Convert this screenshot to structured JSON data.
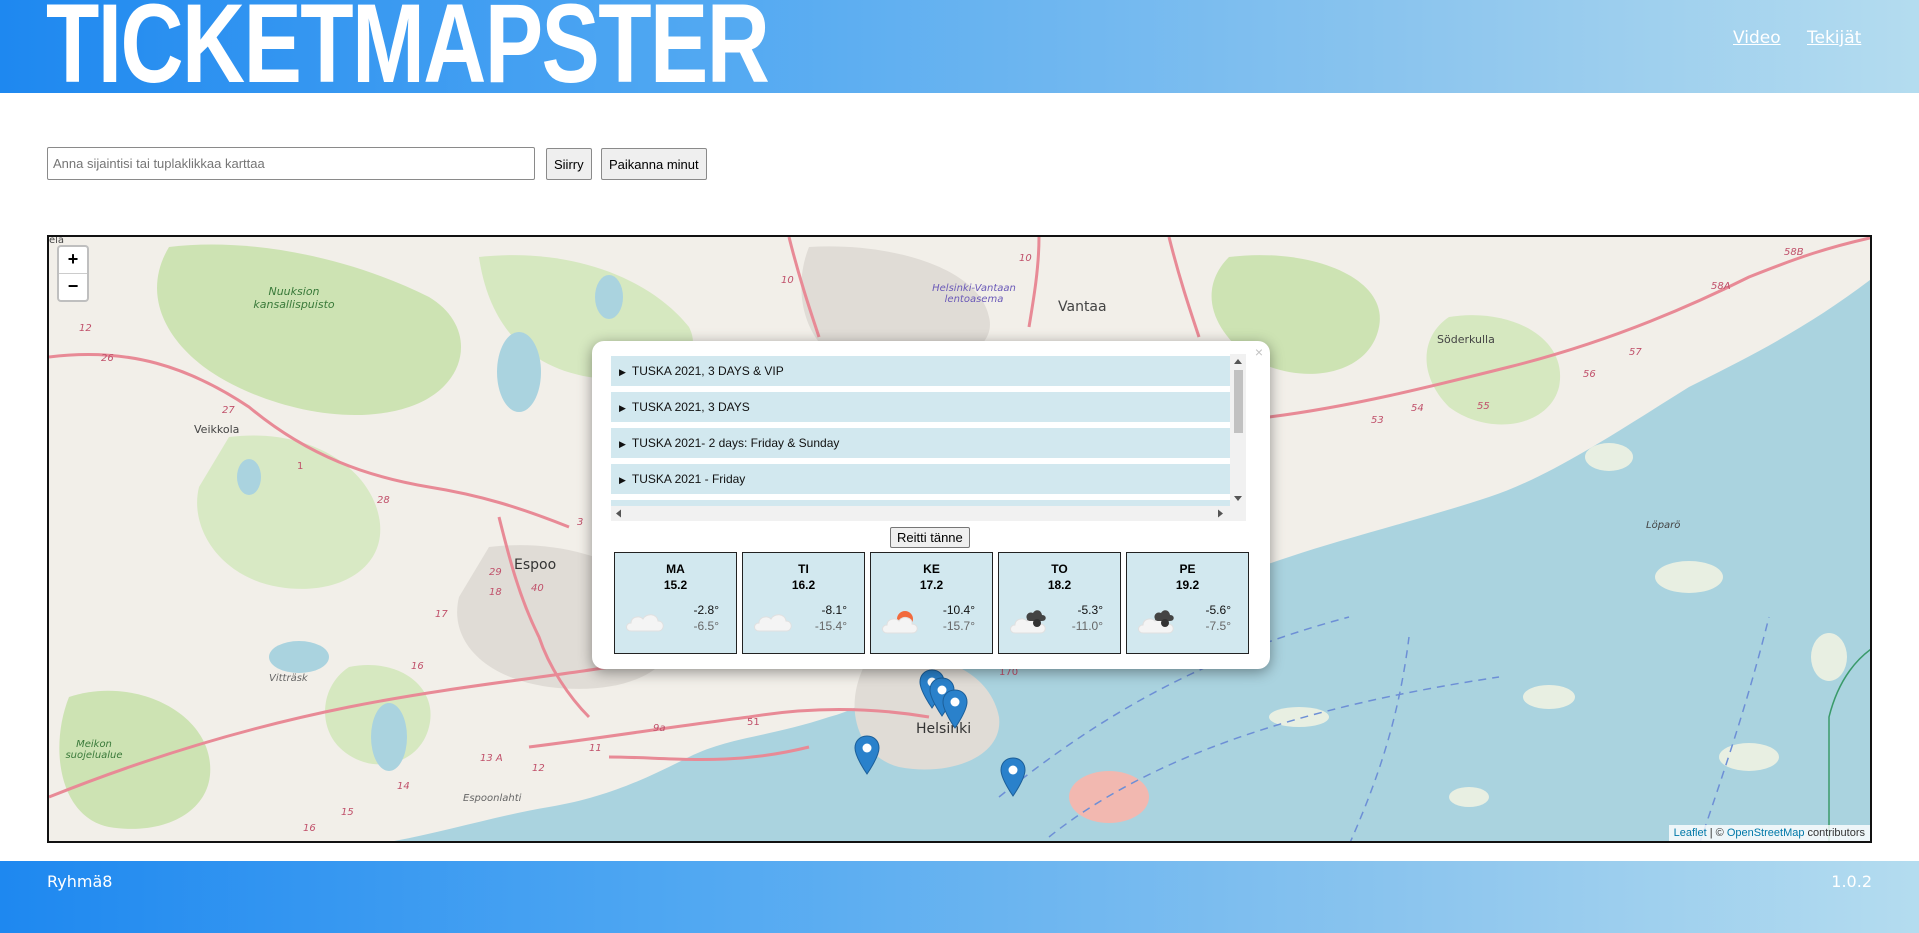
{
  "header": {
    "logo": "TICKETMAPSTER",
    "nav": [
      {
        "label": "Video"
      },
      {
        "label": "Tekijät"
      }
    ]
  },
  "search": {
    "placeholder": "Anna sijaintisi tai tuplaklikkaa karttaa",
    "value": "",
    "go_label": "Siirry",
    "locate_label": "Paikanna minut"
  },
  "map": {
    "zoom_in": "+",
    "zoom_out": "−",
    "corner_label": "ela",
    "places": [
      {
        "name": "Vantaa"
      },
      {
        "name": "Helsinki-Vantaan lentoasema"
      },
      {
        "name": "Nuuksion kansallispuisto"
      },
      {
        "name": "Veikkola"
      },
      {
        "name": "Espoo"
      },
      {
        "name": "Helsinki"
      },
      {
        "name": "Söderkulla"
      },
      {
        "name": "Löparö"
      },
      {
        "name": "Vitträsk"
      },
      {
        "name": "Meikon suojelualue"
      },
      {
        "name": "Espoonlahti"
      }
    ],
    "road_numbers": [
      "10",
      "10",
      "12",
      "26",
      "27",
      "1",
      "28",
      "29",
      "40",
      "18",
      "17",
      "16",
      "51",
      "9a",
      "11",
      "13 A",
      "12",
      "14",
      "15",
      "16",
      "53",
      "54",
      "55",
      "56",
      "57",
      "58A",
      "58B",
      "170",
      "3"
    ],
    "attribution": {
      "leaflet": "Leaflet",
      "separator": " | © ",
      "osm": "OpenStreetMap",
      "suffix": " contributors"
    }
  },
  "popup": {
    "close": "×",
    "tickets": [
      {
        "label": "TUSKA 2021, 3 DAYS & VIP"
      },
      {
        "label": "TUSKA 2021, 3 DAYS"
      },
      {
        "label": "TUSKA 2021- 2 days: Friday & Sunday"
      },
      {
        "label": "TUSKA 2021 - Friday"
      }
    ],
    "route_label": "Reitti tänne",
    "weather": [
      {
        "day": "MA",
        "date": "15.2",
        "high": "-2.8°",
        "low": "-6.5°",
        "icon": "cloud-icon"
      },
      {
        "day": "TI",
        "date": "16.2",
        "high": "-8.1°",
        "low": "-15.4°",
        "icon": "cloud-icon"
      },
      {
        "day": "KE",
        "date": "17.2",
        "high": "-10.4°",
        "low": "-15.7°",
        "icon": "sun-cloud-icon"
      },
      {
        "day": "TO",
        "date": "18.2",
        "high": "-5.3°",
        "low": "-11.0°",
        "icon": "dark-clouds-icon"
      },
      {
        "day": "PE",
        "date": "19.2",
        "high": "-5.6°",
        "low": "-7.5°",
        "icon": "dark-clouds-icon"
      }
    ]
  },
  "footer": {
    "left": "Ryhmä8",
    "right": "1.0.2"
  },
  "colors": {
    "accent": "#1e88f0",
    "ticket_bg": "#d2e8ef",
    "marker": "#2a81cb",
    "water": "#aad3df"
  }
}
